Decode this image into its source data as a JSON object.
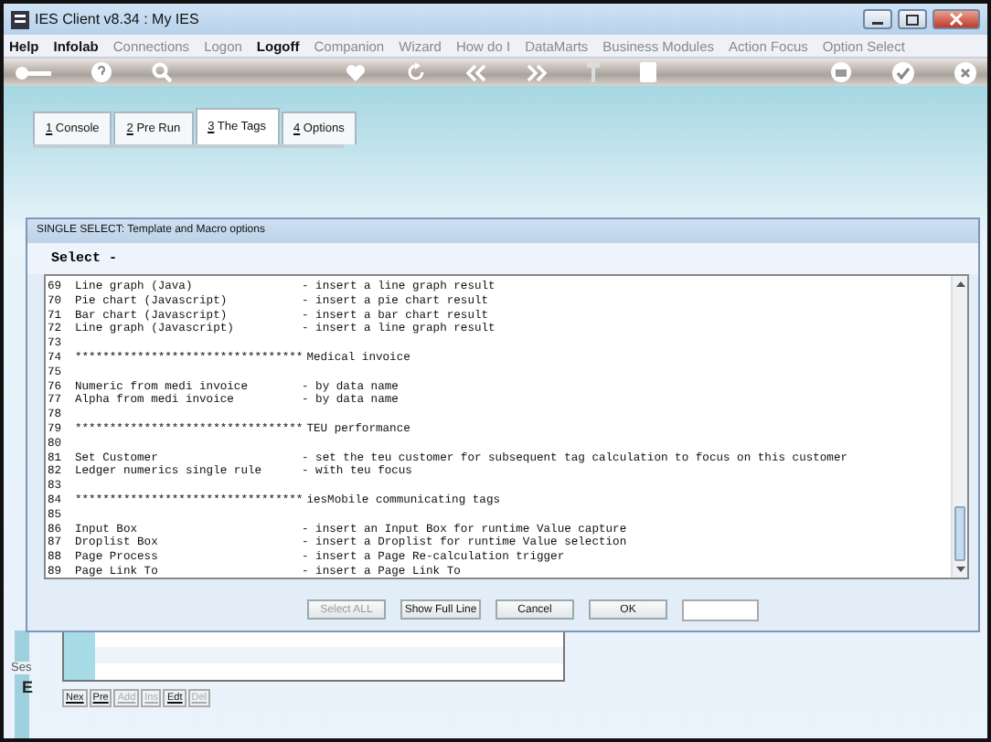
{
  "window": {
    "title": "IES Client v8.34 : My IES"
  },
  "menu": [
    {
      "label": "Help",
      "enabled": true
    },
    {
      "label": "Infolab",
      "enabled": true
    },
    {
      "label": "Connections",
      "enabled": false
    },
    {
      "label": "Logon",
      "enabled": false
    },
    {
      "label": "Logoff",
      "enabled": true
    },
    {
      "label": "Companion",
      "enabled": false
    },
    {
      "label": "Wizard",
      "enabled": false
    },
    {
      "label": "How do I",
      "enabled": false
    },
    {
      "label": "DataMarts",
      "enabled": false
    },
    {
      "label": "Business Modules",
      "enabled": false
    },
    {
      "label": "Action Focus",
      "enabled": false
    },
    {
      "label": "Option Select",
      "enabled": false
    }
  ],
  "toolbar": [
    {
      "kind": "key"
    },
    {
      "kind": "help"
    },
    {
      "kind": "search"
    },
    {
      "kind": "gap"
    },
    {
      "kind": "heart"
    },
    {
      "kind": "refresh"
    },
    {
      "kind": "back"
    },
    {
      "kind": "forward"
    },
    {
      "kind": "pin"
    },
    {
      "kind": "page"
    },
    {
      "kind": "gap"
    },
    {
      "kind": "print"
    },
    {
      "kind": "check"
    },
    {
      "kind": "close"
    }
  ],
  "tabs": [
    {
      "key": "1",
      "label": " Console",
      "selected": false
    },
    {
      "key": "2",
      "label": " Pre Run",
      "selected": false
    },
    {
      "key": "3",
      "label": " The Tags",
      "selected": true
    },
    {
      "key": "4",
      "label": " Options",
      "selected": false
    }
  ],
  "background_panel": {
    "labels": [
      "Ses",
      "E"
    ],
    "buttons": [
      {
        "label": "Nex",
        "disabled": false
      },
      {
        "label": "Pre",
        "disabled": false
      },
      {
        "label": "Add",
        "disabled": true
      },
      {
        "label": "Ins",
        "disabled": true
      },
      {
        "label": "Edt",
        "disabled": false
      },
      {
        "label": "Del",
        "disabled": true
      }
    ]
  },
  "dialog": {
    "title": "SINGLE SELECT: Template and Macro options",
    "heading": "Select -",
    "lines": [
      {
        "number": "69",
        "name": "Line graph (Java)",
        "desc": "- insert a line graph result"
      },
      {
        "number": "70",
        "name": "Pie chart (Javascript)",
        "desc": "- insert a pie chart result"
      },
      {
        "number": "71",
        "name": "Bar chart (Javascript)",
        "desc": "- insert a bar chart result"
      },
      {
        "number": "72",
        "name": "Line graph (Javascript)",
        "desc": "- insert a line graph result"
      },
      {
        "number": "73"
      },
      {
        "number": "74",
        "name": "*********************************",
        "desc": "Medical invoice"
      },
      {
        "number": "75"
      },
      {
        "number": "76",
        "name": "Numeric from medi invoice",
        "desc": "- by data name"
      },
      {
        "number": "77",
        "name": "Alpha from medi invoice",
        "desc": "- by data name"
      },
      {
        "number": "78"
      },
      {
        "number": "79",
        "name": "*********************************",
        "desc": "TEU performance"
      },
      {
        "number": "80"
      },
      {
        "number": "81",
        "name": "Set Customer",
        "desc": "- set the teu customer for subsequent tag calculation to focus on this customer"
      },
      {
        "number": "82",
        "name": "Ledger numerics single rule",
        "desc": "- with teu focus"
      },
      {
        "number": "83"
      },
      {
        "number": "84",
        "name": "*********************************",
        "desc": "iesMobile communicating tags"
      },
      {
        "number": "85"
      },
      {
        "number": "86",
        "name": "Input Box",
        "desc": "- insert an Input Box for runtime Value capture"
      },
      {
        "number": "87",
        "name": "Droplist Box",
        "desc": "- insert a Droplist for runtime Value selection"
      },
      {
        "number": "88",
        "name": "Page Process",
        "desc": "- insert a Page Re-calculation trigger"
      },
      {
        "number": "89",
        "name": "Page Link To",
        "desc": "- insert a Page Link To"
      }
    ],
    "buttons": [
      {
        "label": "Select ALL",
        "disabled": true
      },
      {
        "label": "Show Full Line",
        "disabled": false
      },
      {
        "label": "Cancel",
        "disabled": false
      },
      {
        "label": "OK",
        "disabled": false
      }
    ]
  }
}
